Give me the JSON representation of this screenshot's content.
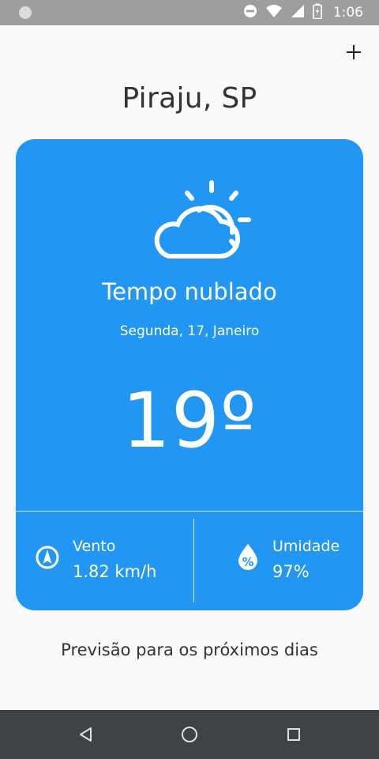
{
  "status_bar": {
    "time": "1:06",
    "icons": [
      "do-not-disturb-icon",
      "wifi-icon",
      "signal-icon",
      "battery-icon"
    ]
  },
  "header": {
    "add_icon": "plus-icon",
    "city": "Piraju, SP"
  },
  "current": {
    "icon": "partly-cloudy-icon",
    "condition": "Tempo nublado",
    "date": "Segunda, 17, Janeiro",
    "temperature": "19º"
  },
  "details": {
    "wind": {
      "icon": "compass-icon",
      "label": "Vento",
      "value": "1.82 km/h"
    },
    "humidity": {
      "icon": "humidity-drop-icon",
      "label": "Umidade",
      "value": "97%"
    }
  },
  "forecast": {
    "heading": "Previsão para os próximos dias"
  },
  "nav_bar": {
    "buttons": [
      "back-icon",
      "home-icon",
      "recents-icon"
    ]
  },
  "colors": {
    "card": "#2196f3",
    "background": "#fafafa",
    "text": "#333333",
    "status_bar": "#9e9e9e",
    "nav_bar": "#3f4348"
  }
}
